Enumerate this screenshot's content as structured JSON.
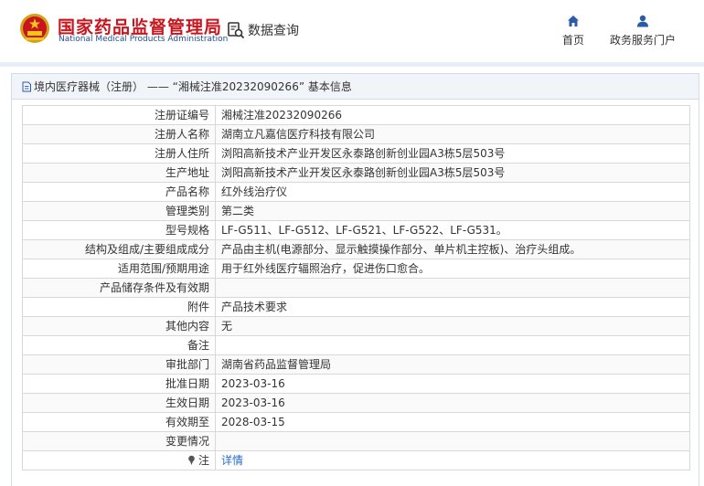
{
  "header": {
    "title_cn": "国家药品监督管理局",
    "title_en": "National Medical Products Administration",
    "search_label": "数据查询",
    "nav": {
      "home": "首页",
      "gov": "政务服务门户"
    },
    "colors": {
      "brand_red": "#c7161e",
      "brand_blue": "#1f4e8c",
      "nav_blue": "#2a5aa8"
    }
  },
  "panel": {
    "title": "境内医疗器械（注册） —— “湘械注准20232090266” 基本信息"
  },
  "rows": [
    {
      "label": "注册证编号",
      "value": "湘械注准20232090266"
    },
    {
      "label": "注册人名称",
      "value": "湖南立凡嘉信医疗科技有限公司"
    },
    {
      "label": "注册人住所",
      "value": "浏阳高新技术产业开发区永泰路创新创业园A3栋5层503号"
    },
    {
      "label": "生产地址",
      "value": "浏阳高新技术产业开发区永泰路创新创业园A3栋5层503号"
    },
    {
      "label": "产品名称",
      "value": "红外线治疗仪"
    },
    {
      "label": "管理类别",
      "value": "第二类"
    },
    {
      "label": "型号规格",
      "value": "LF-G511、LF-G512、LF-G521、LF-G522、LF-G531。"
    },
    {
      "label": "结构及组成/主要组成成分",
      "value": "产品由主机(电源部分、显示触摸操作部分、单片机主控板)、治疗头组成。"
    },
    {
      "label": "适用范围/预期用途",
      "value": "用于红外线医疗辐照治疗，促进伤口愈合。"
    },
    {
      "label": "产品储存条件及有效期",
      "value": ""
    },
    {
      "label": "附件",
      "value": "产品技术要求"
    },
    {
      "label": "其他内容",
      "value": "无"
    },
    {
      "label": "备注",
      "value": ""
    },
    {
      "label": "审批部门",
      "value": "湖南省药品监督管理局"
    },
    {
      "label": "批准日期",
      "value": "2023-03-16"
    },
    {
      "label": "生效日期",
      "value": "2023-03-16"
    },
    {
      "label": "有效期至",
      "value": "2028-03-15"
    },
    {
      "label": "变更情况",
      "value": ""
    }
  ],
  "note_row": {
    "label": "注",
    "link": "详情",
    "icon": "note-pin-icon"
  }
}
